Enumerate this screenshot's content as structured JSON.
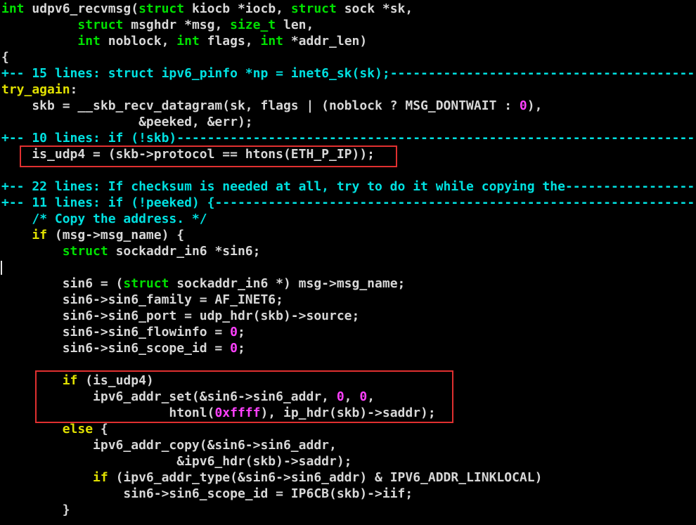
{
  "colors": {
    "background": "#000000",
    "text": "#d7d7d7",
    "keyword": "#00e000",
    "type": "#00e000",
    "fold": "#00e0e0",
    "label": "#e0e000",
    "conditional": "#e0e000",
    "comment": "#00e0e0",
    "number": "#ff40ff",
    "highlight_border": "#e03030"
  },
  "editor": {
    "lines": [
      [
        {
          "t": "int",
          "c": "keyword"
        },
        {
          "t": " udpv6_recvmsg(",
          "c": "text"
        },
        {
          "t": "struct",
          "c": "keyword"
        },
        {
          "t": " kiocb *iocb, ",
          "c": "text"
        },
        {
          "t": "struct",
          "c": "keyword"
        },
        {
          "t": " sock *sk,",
          "c": "text"
        }
      ],
      [
        {
          "t": "          ",
          "c": "text"
        },
        {
          "t": "struct",
          "c": "keyword"
        },
        {
          "t": " msghdr *msg, ",
          "c": "text"
        },
        {
          "t": "size_t",
          "c": "type"
        },
        {
          "t": " len,",
          "c": "text"
        }
      ],
      [
        {
          "t": "          ",
          "c": "text"
        },
        {
          "t": "int",
          "c": "keyword"
        },
        {
          "t": " noblock, ",
          "c": "text"
        },
        {
          "t": "int",
          "c": "keyword"
        },
        {
          "t": " flags, ",
          "c": "text"
        },
        {
          "t": "int",
          "c": "keyword"
        },
        {
          "t": " *addr_len)",
          "c": "text"
        }
      ],
      [
        {
          "t": "{",
          "c": "text"
        }
      ],
      [
        {
          "t": "+-- 15 lines: struct ipv6_pinfo *np = inet6_sk(sk);",
          "c": "fold"
        },
        {
          "t": "---------------------------------------------------------------",
          "c": "fold",
          "fill": true
        }
      ],
      [
        {
          "t": "try_again",
          "c": "label"
        },
        {
          "t": ":",
          "c": "text"
        }
      ],
      [
        {
          "t": "    skb = __skb_recv_datagram(sk, flags | (noblock ? MSG_DONTWAIT : ",
          "c": "text"
        },
        {
          "t": "0",
          "c": "number"
        },
        {
          "t": "),",
          "c": "text"
        }
      ],
      [
        {
          "t": "                  &peeked, &err);",
          "c": "text"
        }
      ],
      [
        {
          "t": "+-- 10 lines: if (!skb)",
          "c": "fold"
        },
        {
          "t": "---------------------------------------------------------------------------------------------",
          "c": "fold",
          "fill": true
        }
      ],
      [
        {
          "t": "    is_udp4 = (skb->protocol == htons(ETH_P_IP));",
          "c": "text"
        }
      ],
      [],
      [
        {
          "t": "+-- 22 lines: If checksum is needed at all, try to do it while copying the",
          "c": "fold"
        },
        {
          "t": "-------------------------------------------",
          "c": "fold",
          "fill": true
        }
      ],
      [
        {
          "t": "+-- 11 lines: if (!peeked) {",
          "c": "fold"
        },
        {
          "t": "---------------------------------------------------------------------------------------------",
          "c": "fold",
          "fill": true
        }
      ],
      [
        {
          "t": "    ",
          "c": "text"
        },
        {
          "t": "/* Copy the address. */",
          "c": "comment"
        }
      ],
      [
        {
          "t": "    ",
          "c": "text"
        },
        {
          "t": "if",
          "c": "conditional"
        },
        {
          "t": " (msg->msg_name) {",
          "c": "text"
        }
      ],
      [
        {
          "t": "        ",
          "c": "text"
        },
        {
          "t": "struct",
          "c": "keyword"
        },
        {
          "t": " sockaddr_in6 *sin6;",
          "c": "text"
        }
      ],
      [],
      [
        {
          "t": "        sin6 = (",
          "c": "text"
        },
        {
          "t": "struct",
          "c": "keyword"
        },
        {
          "t": " sockaddr_in6 *) msg->msg_name;",
          "c": "text"
        }
      ],
      [
        {
          "t": "        sin6->sin6_family = AF_INET6;",
          "c": "text"
        }
      ],
      [
        {
          "t": "        sin6->sin6_port = udp_hdr(skb)->source;",
          "c": "text"
        }
      ],
      [
        {
          "t": "        sin6->sin6_flowinfo = ",
          "c": "text"
        },
        {
          "t": "0",
          "c": "number"
        },
        {
          "t": ";",
          "c": "text"
        }
      ],
      [
        {
          "t": "        sin6->sin6_scope_id = ",
          "c": "text"
        },
        {
          "t": "0",
          "c": "number"
        },
        {
          "t": ";",
          "c": "text"
        }
      ],
      [],
      [
        {
          "t": "        ",
          "c": "text"
        },
        {
          "t": "if",
          "c": "conditional"
        },
        {
          "t": " (is_udp4)",
          "c": "text"
        }
      ],
      [
        {
          "t": "            ipv6_addr_set(&sin6->sin6_addr, ",
          "c": "text"
        },
        {
          "t": "0",
          "c": "number"
        },
        {
          "t": ", ",
          "c": "text"
        },
        {
          "t": "0",
          "c": "number"
        },
        {
          "t": ",",
          "c": "text"
        }
      ],
      [
        {
          "t": "                      htonl(",
          "c": "text"
        },
        {
          "t": "0xffff",
          "c": "number"
        },
        {
          "t": "), ip_hdr(skb)->saddr);",
          "c": "text"
        }
      ],
      [
        {
          "t": "        ",
          "c": "text"
        },
        {
          "t": "else",
          "c": "conditional"
        },
        {
          "t": " {",
          "c": "text"
        }
      ],
      [
        {
          "t": "            ipv6_addr_copy(&sin6->sin6_addr,",
          "c": "text"
        }
      ],
      [
        {
          "t": "                       &ipv6_hdr(skb)->saddr);",
          "c": "text"
        }
      ],
      [
        {
          "t": "            ",
          "c": "text"
        },
        {
          "t": "if",
          "c": "conditional"
        },
        {
          "t": " (ipv6_addr_type(&sin6->sin6_addr) & IPV6_ADDR_LINKLOCAL)",
          "c": "text"
        }
      ],
      [
        {
          "t": "                sin6->sin6_scope_id = IP6CB(skb)->iif;",
          "c": "text"
        }
      ],
      [
        {
          "t": "        }",
          "c": "text"
        }
      ]
    ]
  }
}
